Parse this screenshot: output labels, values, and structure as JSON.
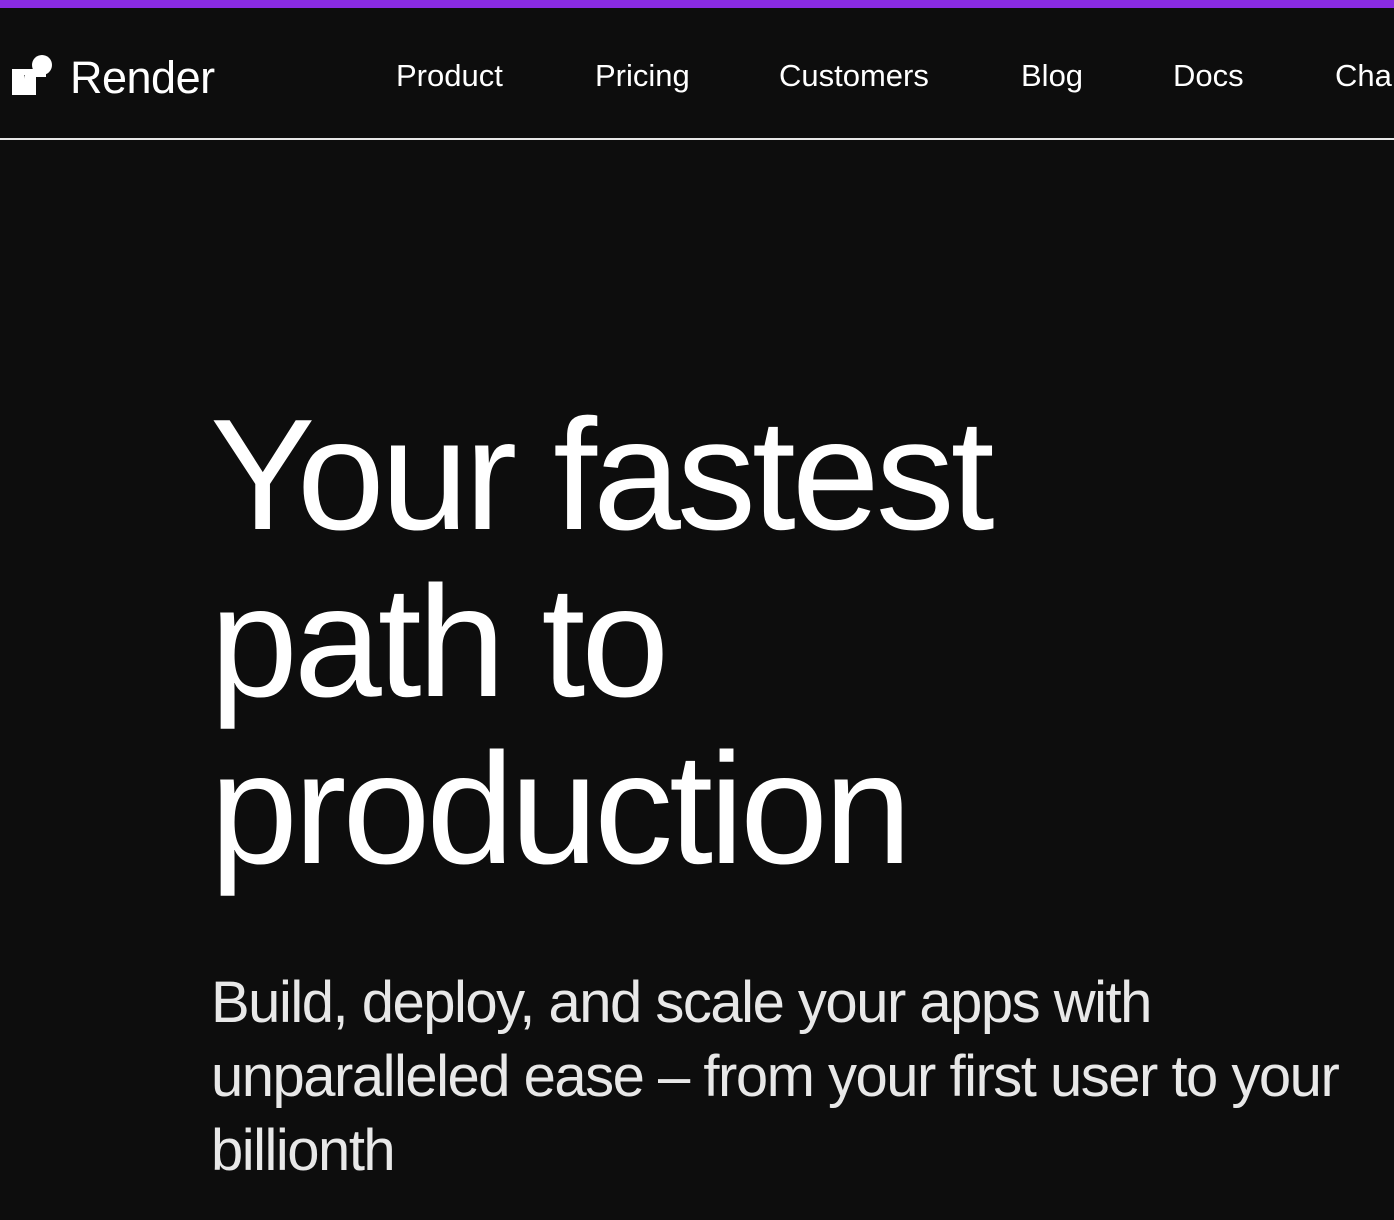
{
  "brand": {
    "name": "Render",
    "accent_color": "#8a2be2",
    "background": "#0d0d0d",
    "logo_icon": "render-logo-icon"
  },
  "nav": {
    "items": [
      {
        "label": "Product"
      },
      {
        "label": "Pricing"
      },
      {
        "label": "Customers"
      },
      {
        "label": "Blog"
      },
      {
        "label": "Docs"
      },
      {
        "label": "Cha"
      }
    ]
  },
  "hero": {
    "title_lines": [
      "Your fastest",
      "path to",
      "production"
    ],
    "subtitle_lines": [
      "Build, deploy, and scale your apps with",
      "unparalleled ease – from your first user to your",
      "billionth"
    ]
  }
}
